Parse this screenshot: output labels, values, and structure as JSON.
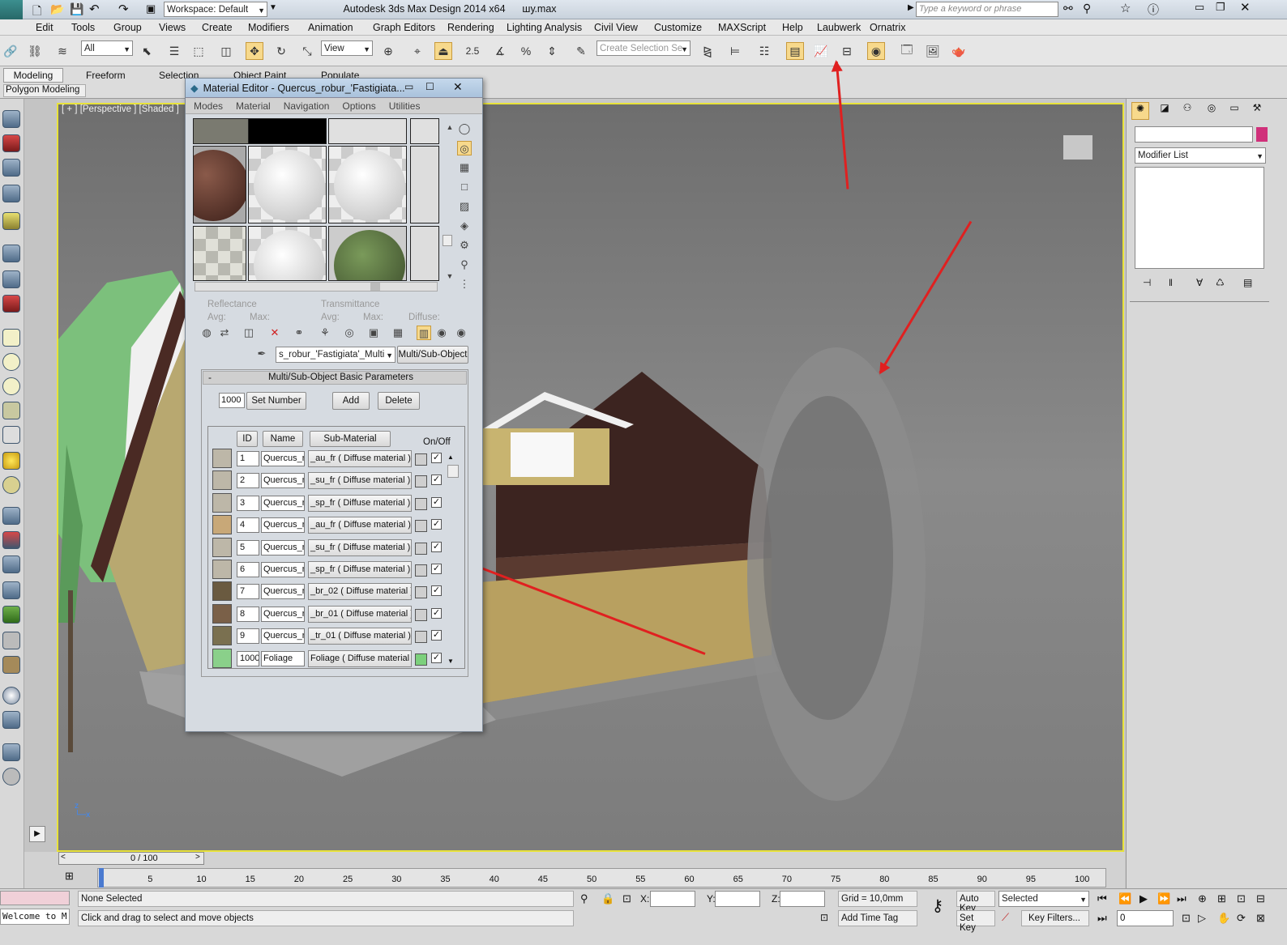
{
  "app": {
    "title": "Autodesk 3ds Max Design 2014 x64",
    "filename": "шу.max",
    "workspace": "Workspace: Default",
    "search_placeholder": "Type a keyword or phrase"
  },
  "menu": [
    "Edit",
    "Tools",
    "Group",
    "Views",
    "Create",
    "Modifiers",
    "Animation",
    "Graph Editors",
    "Rendering",
    "Lighting Analysis",
    "Civil View",
    "Customize",
    "MAXScript",
    "Help",
    "Laubwerk",
    "Ornatrix"
  ],
  "toolbar": {
    "filter": "All",
    "ref_coord": "View",
    "angle_value": "2.5",
    "selection_set_placeholder": "Create Selection Se"
  },
  "ribbon": {
    "tabs": [
      "Modeling",
      "Freeform",
      "Selection",
      "Object Paint",
      "Populate"
    ],
    "subtitle": "Polygon Modeling"
  },
  "viewport": {
    "label": "[ + ] [Perspective ] [Shaded ]"
  },
  "material_editor": {
    "title": "Material Editor - Quercus_robur_'Fastigiata...",
    "menu": [
      "Modes",
      "Material",
      "Navigation",
      "Options",
      "Utilities"
    ],
    "reflectance": "Reflectance",
    "transmittance": "Transmittance",
    "avg": "Avg:",
    "max": "Max:",
    "diffuse": "Diffuse:",
    "material_name": "s_robur_'Fastigiata'_Multi",
    "material_type": "Multi/Sub-Object",
    "rollout_title": "Multi/Sub-Object Basic Parameters",
    "collapse": "-",
    "count": "1000",
    "set_number": "Set Number",
    "add": "Add",
    "delete": "Delete",
    "col_id": "ID",
    "col_name": "Name",
    "col_sub": "Sub-Material",
    "col_onoff": "On/Off",
    "rows": [
      {
        "id": "1",
        "name": "Quercus_r",
        "sub": "_au_fr  ( Diffuse material )",
        "checked": "✓"
      },
      {
        "id": "2",
        "name": "Quercus_r",
        "sub": "_su_fr  ( Diffuse material )",
        "checked": "✓"
      },
      {
        "id": "3",
        "name": "Quercus_r",
        "sub": "_sp_fr  ( Diffuse material )",
        "checked": "✓"
      },
      {
        "id": "4",
        "name": "Quercus_r",
        "sub": "_au_fr  ( Diffuse material )",
        "checked": "✓"
      },
      {
        "id": "5",
        "name": "Quercus_r",
        "sub": "_su_fr  ( Diffuse material )",
        "checked": "✓"
      },
      {
        "id": "6",
        "name": "Quercus_r",
        "sub": "_sp_fr  ( Diffuse material )",
        "checked": "✓"
      },
      {
        "id": "7",
        "name": "Quercus_r",
        "sub": "_br_02  ( Diffuse material )",
        "checked": "✓"
      },
      {
        "id": "8",
        "name": "Quercus_r",
        "sub": "_br_01  ( Diffuse material )",
        "checked": "✓"
      },
      {
        "id": "9",
        "name": "Quercus_r",
        "sub": "_tr_01  ( Diffuse material )",
        "checked": "✓"
      },
      {
        "id": "1000",
        "name": "Foliage",
        "sub": "Foliage  ( Diffuse material )",
        "checked": "✓"
      }
    ]
  },
  "command_panel": {
    "modifier_list": "Modifier List"
  },
  "timeline": {
    "frame": "0 / 100",
    "ticks": [
      "0",
      "5",
      "10",
      "15",
      "20",
      "25",
      "30",
      "35",
      "40",
      "45",
      "50",
      "55",
      "60",
      "65",
      "70",
      "75",
      "80",
      "85",
      "90",
      "95",
      "100"
    ]
  },
  "status": {
    "welcome": "Welcome to M",
    "selection": "None Selected",
    "prompt": "Click and drag to select and move objects",
    "x_label": "X:",
    "y_label": "Y:",
    "z_label": "Z:",
    "grid": "Grid = 10,0mm",
    "add_time_tag": "Add Time Tag",
    "auto_key": "Auto Key",
    "set_key": "Set Key",
    "selected": "Selected",
    "key_filters": "Key Filters...",
    "frame_value": "0"
  },
  "colors": {
    "viewport_border": "#e8e23a",
    "accent": "#f7d98c",
    "arrow": "#e02020"
  }
}
